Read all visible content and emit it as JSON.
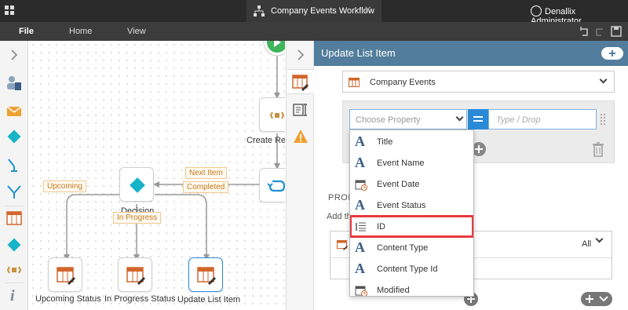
{
  "window": {
    "title": "Company Events Workflow",
    "user": "Denallix Administrator"
  },
  "menu": {
    "file": "File",
    "home": "Home",
    "view": "View"
  },
  "canvas": {
    "nodes": {
      "create_reference": "Create Refe",
      "decision": "Decision",
      "upcoming_status": "Upcoming Status",
      "in_progress_status": "In Progress Status",
      "update_list_item": "Update List Item"
    },
    "tags": {
      "upcoming": "Upcoming",
      "in_progress": "In Progress",
      "next_item": "Next Item",
      "completed": "Completed"
    }
  },
  "panel": {
    "title": "Update List Item",
    "list_select": "Company Events",
    "property_placeholder": "Choose Property",
    "value_placeholder": "Type / Drop",
    "section_label": "PROP",
    "add_text": "Add th",
    "filter_value": "All"
  },
  "dropdown": {
    "options": [
      {
        "label": "Title",
        "icon": "text-a-icon"
      },
      {
        "label": "Event Name",
        "icon": "text-a-icon"
      },
      {
        "label": "Event Date",
        "icon": "calendar-icon"
      },
      {
        "label": "Event Status",
        "icon": "text-a-icon"
      },
      {
        "label": "ID",
        "icon": "list-number-icon",
        "highlighted": true
      },
      {
        "label": "Content Type",
        "icon": "text-a-icon"
      },
      {
        "label": "Content Type Id",
        "icon": "text-a-icon"
      },
      {
        "label": "Modified",
        "icon": "calendar-icon"
      }
    ]
  },
  "colors": {
    "panel_header": "#527d9c",
    "accent_blue": "#2b8ad8",
    "highlight_red": "#e8393f",
    "diamond": "#17b3c8",
    "tag_orange": "#c6771d"
  }
}
